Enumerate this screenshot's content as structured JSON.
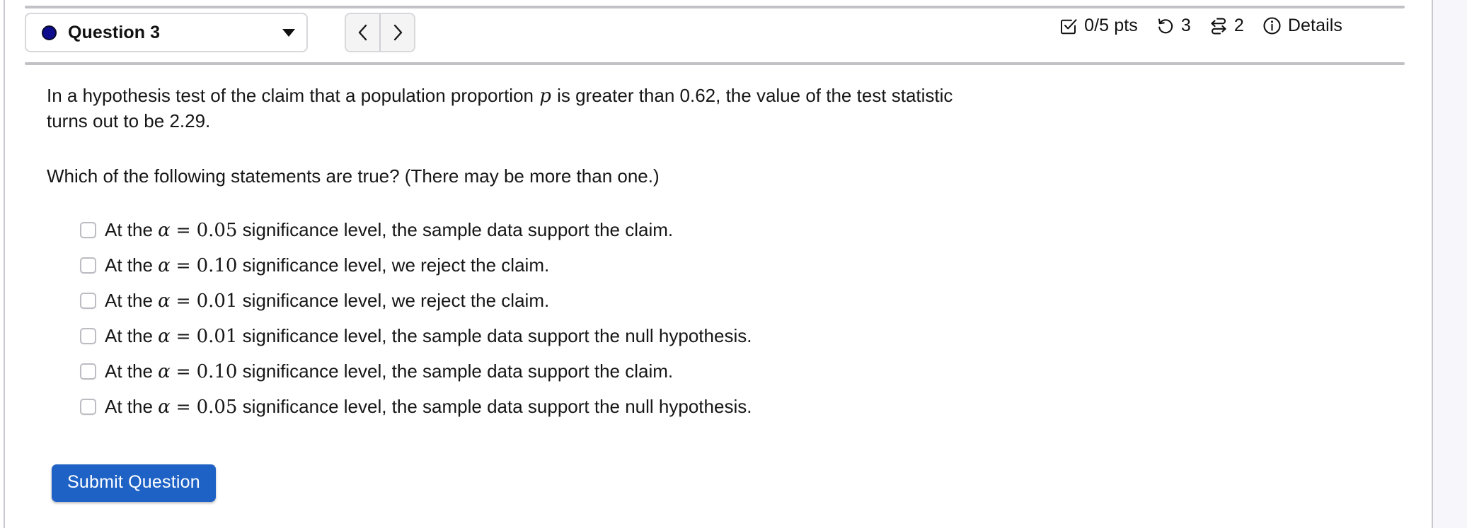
{
  "header": {
    "question_selector": {
      "label": "Question 3",
      "dot_color": "#0d0d8e",
      "caret_icon": "chevron-down-icon"
    },
    "nav": {
      "prev_label": "‹",
      "next_label": "›"
    },
    "status": {
      "points": "0/5 pts",
      "attempts": "3",
      "versions": "2",
      "details": "Details"
    }
  },
  "question": {
    "prompt_part1": "In a hypothesis test of the claim that a population proportion ",
    "prompt_var": "p",
    "prompt_part2": " is greater than 0.62, the value of the test statistic turns out to be 2.29.",
    "subprompt": "Which of the following statements are true? (There may be more than one.)",
    "options": [
      {
        "prefix": "At the ",
        "alpha": "α",
        "eq": " = ",
        "value": "0.05",
        "suffix": " significance level, the sample data support the claim.",
        "checked": false
      },
      {
        "prefix": "At the ",
        "alpha": "α",
        "eq": " = ",
        "value": "0.10",
        "suffix": " significance level, we reject the claim.",
        "checked": false
      },
      {
        "prefix": "At the ",
        "alpha": "α",
        "eq": " = ",
        "value": "0.01",
        "suffix": " significance level, we reject the claim.",
        "checked": false
      },
      {
        "prefix": "At the ",
        "alpha": "α",
        "eq": " = ",
        "value": "0.01",
        "suffix": " significance level, the sample data support the null hypothesis.",
        "checked": false
      },
      {
        "prefix": "At the ",
        "alpha": "α",
        "eq": " = ",
        "value": "0.10",
        "suffix": " significance level, the sample data support the claim.",
        "checked": false
      },
      {
        "prefix": "At the ",
        "alpha": "α",
        "eq": " = ",
        "value": "0.05",
        "suffix": " significance level, the sample data support the null hypothesis.",
        "checked": false
      }
    ]
  },
  "actions": {
    "submit_label": "Submit Question",
    "submit_color": "#1f62c6"
  }
}
